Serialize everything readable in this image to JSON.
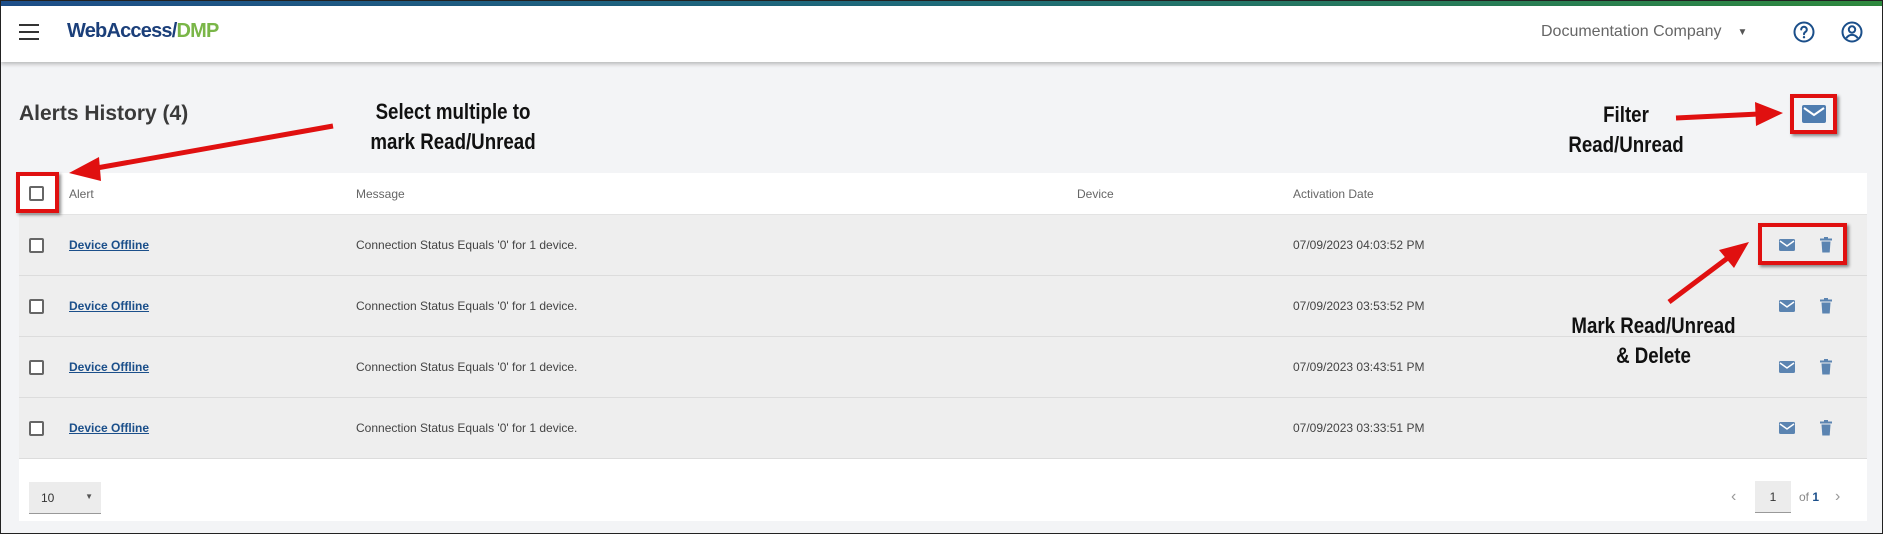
{
  "app": {
    "logo_part1": "WebAccess/",
    "logo_part2": "DMP",
    "company": "Documentation Company"
  },
  "page": {
    "title": "Alerts History (4)"
  },
  "table": {
    "columns": [
      "Alert",
      "Message",
      "Device",
      "Activation Date"
    ],
    "rows": [
      {
        "alert": "Device Offline",
        "message": "Connection Status Equals '0' for 1 device.",
        "device": "",
        "date": "07/09/2023 04:03:52 PM"
      },
      {
        "alert": "Device Offline",
        "message": "Connection Status Equals '0' for 1 device.",
        "device": "",
        "date": "07/09/2023 03:53:52 PM"
      },
      {
        "alert": "Device Offline",
        "message": "Connection Status Equals '0' for 1 device.",
        "device": "",
        "date": "07/09/2023 03:43:51 PM"
      },
      {
        "alert": "Device Offline",
        "message": "Connection Status Equals '0' for 1 device.",
        "device": "",
        "date": "07/09/2023 03:33:51 PM"
      }
    ]
  },
  "pagination": {
    "rows_per_page": "10",
    "current_page": "1",
    "of_label": "of",
    "total_pages": "1"
  },
  "annotations": {
    "select_multiple_line1": "Select multiple to",
    "select_multiple_line2": "mark Read/Unread",
    "filter_line1": "Filter",
    "filter_line2": "Read/Unread",
    "mark_line1": "Mark Read/Unread",
    "mark_line2": "& Delete"
  },
  "icons": {
    "menu": "hamburger-icon",
    "help": "help-circle-icon",
    "account": "account-circle-icon",
    "filter": "mail-icon",
    "mark": "mail-icon",
    "delete": "trash-icon"
  },
  "colors": {
    "brand_blue": "#1b3f7a",
    "brand_green": "#7ab648",
    "link": "#1b4f8a",
    "icon_blue": "#5b84b1",
    "annotation_red": "#e01010"
  }
}
